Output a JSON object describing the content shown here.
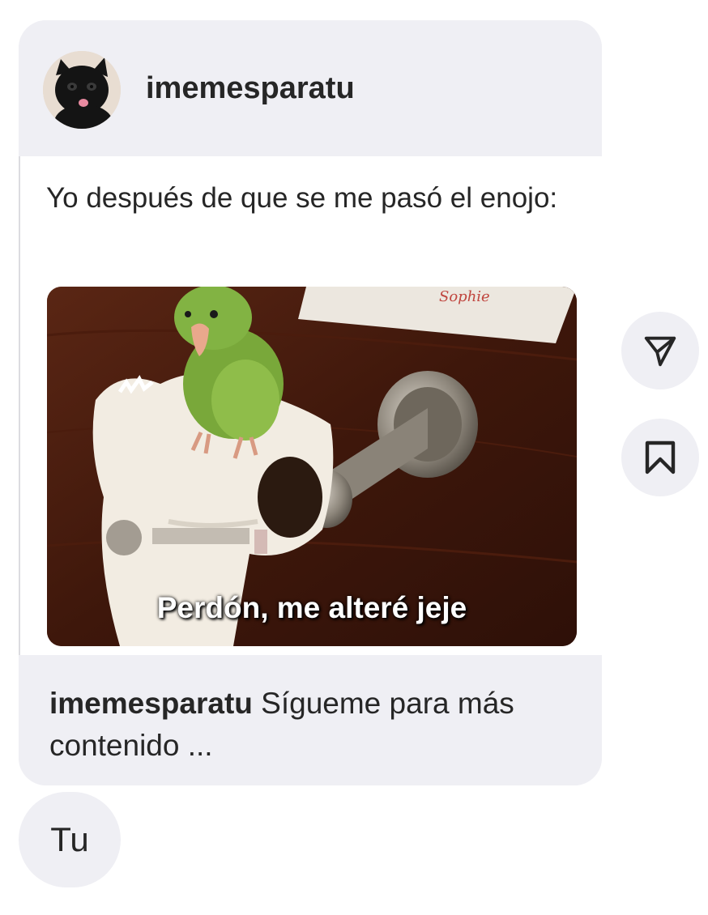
{
  "post": {
    "username": "imemesparatu",
    "avatar_icon": "black-cat-avatar",
    "text": "Yo después de que se me pasó el enojo:",
    "image": {
      "description_icon": "parrot-toilet-paper-meme",
      "caption": "Perdón, me alteré jeje",
      "note_text": "Sophie"
    },
    "footer": {
      "username": "imemesparatu",
      "caption": "Sígueme para más contenido ..."
    }
  },
  "actions": {
    "share_icon": "send-icon",
    "save_icon": "bookmark-icon"
  },
  "reply": {
    "text": "Tu"
  },
  "colors": {
    "bubble_bg": "#efeff4",
    "text": "#262626"
  }
}
